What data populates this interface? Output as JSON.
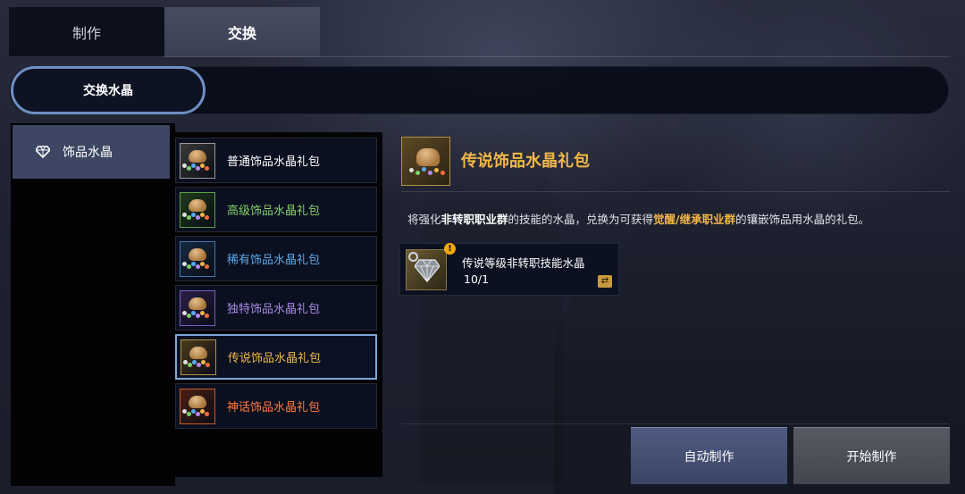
{
  "tabs": [
    {
      "label": "制作",
      "active": false
    },
    {
      "label": "交换",
      "active": true
    }
  ],
  "subtab": {
    "label": "交换水晶"
  },
  "category": {
    "label": "饰品水晶",
    "icon": "diamond-icon"
  },
  "items": [
    {
      "label": "普通饰品水晶礼包",
      "color": "#ffffff",
      "frame": "#9a9a9a",
      "frame_bg": "#3a3a3a"
    },
    {
      "label": "高级饰品水晶礼包",
      "color": "#84d06b",
      "frame": "#5aa14a",
      "frame_bg": "#1f3a1a"
    },
    {
      "label": "稀有饰品水晶礼包",
      "color": "#5da9e9",
      "frame": "#3f79b4",
      "frame_bg": "#16293f"
    },
    {
      "label": "独特饰品水晶礼包",
      "color": "#a98ae6",
      "frame": "#7a5cc4",
      "frame_bg": "#2a1f45"
    },
    {
      "label": "传说饰品水晶礼包",
      "color": "#f1b748",
      "frame": "#b39046",
      "frame_bg": "#4a3a1a",
      "selected": true
    },
    {
      "label": "神话饰品水晶礼包",
      "color": "#ff7a3c",
      "frame": "#c45a2a",
      "frame_bg": "#4a1f12"
    }
  ],
  "detail": {
    "title": "传说饰品水晶礼包",
    "desc_parts": [
      {
        "text": "将强化",
        "style": "normal"
      },
      {
        "text": "非转职职业群",
        "style": "blue"
      },
      {
        "text": "的技能的水晶，兑换为可获得",
        "style": "normal"
      },
      {
        "text": "觉醒/继承职业群",
        "style": "gold"
      },
      {
        "text": "的镶嵌饰品用水晶的礼包。",
        "style": "normal"
      }
    ]
  },
  "material": {
    "name": "传说等级非转职技能水晶",
    "count": "10/1",
    "badge": "!",
    "icon": "crystal-icon",
    "swap_icon": "swap-icon"
  },
  "buttons": {
    "auto": "自动制作",
    "start": "开始制作"
  },
  "colors": {
    "accent_blue": "#7fa7d6",
    "legend_gold": "#f1b748"
  }
}
